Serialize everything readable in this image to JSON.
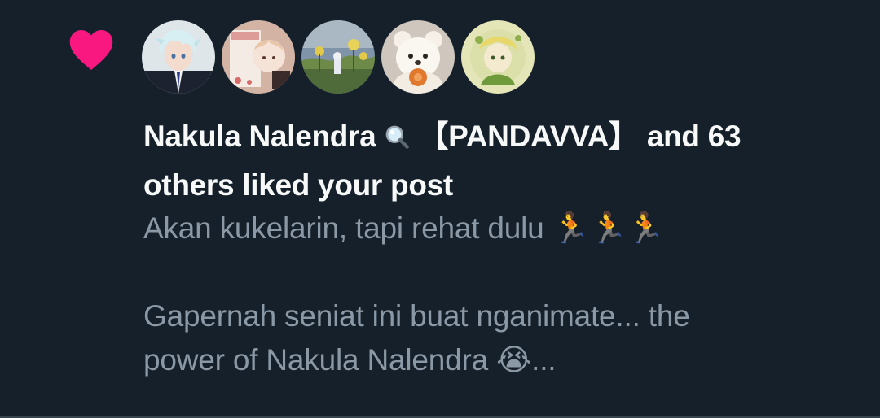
{
  "notification": {
    "type_icon": "heart-icon",
    "accent_color": "#f91880",
    "avatars": [
      {
        "name": "avatar-anime-white-hair",
        "icon": "avatar-icon"
      },
      {
        "name": "avatar-happy-birthday",
        "icon": "avatar-icon"
      },
      {
        "name": "avatar-flowers-field",
        "icon": "avatar-icon"
      },
      {
        "name": "avatar-teddy-bear",
        "icon": "avatar-icon"
      },
      {
        "name": "avatar-green-character",
        "icon": "avatar-icon"
      }
    ],
    "user_name": "Nakula Nalendra",
    "user_emoji_icon": "magnifying-glass-icon",
    "user_tag": "【PANDAVVA】",
    "and_text": "and 63",
    "rest_text": "others liked your post"
  },
  "post": {
    "line1": "Akan kukelarin, tapi rehat dulu",
    "line1_emoji": "🏃🏃🏃",
    "line3": "Gapernah seniat ini buat nganimate... the",
    "line4": "power of Nakula Nalendra",
    "line4_emoji": "😭",
    "line4_end": "..."
  },
  "colors": {
    "background": "#15202b",
    "primary_text": "#f7f9f9",
    "secondary_text": "#8b98a5",
    "divider": "#38444d"
  }
}
